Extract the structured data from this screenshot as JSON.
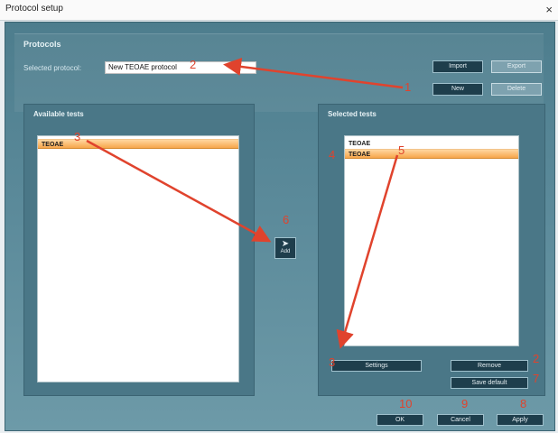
{
  "window": {
    "title": "Protocol setup",
    "close_glyph": "×"
  },
  "protocols": {
    "header": "Protocols",
    "selected_label": "Selected protocol:",
    "selected_value": "New TEOAE protocol",
    "buttons": {
      "import": "Import",
      "export": "Export",
      "new": "New",
      "delete": "Delete"
    }
  },
  "available": {
    "header": "Available tests",
    "items": [
      "TEOAE"
    ]
  },
  "selected": {
    "header": "Selected tests",
    "items": [
      "TEOAE",
      "TEOAE"
    ]
  },
  "actions": {
    "add": "Add",
    "settings": "Settings",
    "remove": "Remove",
    "save_default": "Save default"
  },
  "footer": {
    "ok": "OK",
    "cancel": "Cancel",
    "apply": "Apply"
  },
  "annotations": [
    "1",
    "2",
    "3",
    "4",
    "5",
    "6",
    "7",
    "8",
    "9",
    "10",
    "2",
    "3"
  ],
  "colors": {
    "accent": "#e0432d",
    "selection": "#f7a64b",
    "panel": "#4a7787"
  }
}
